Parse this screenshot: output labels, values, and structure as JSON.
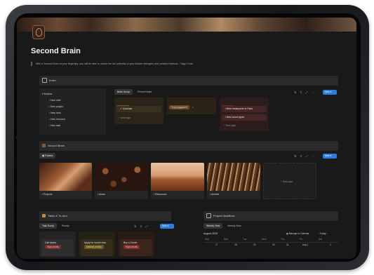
{
  "page": {
    "title": "Second Brain",
    "quote": "With a Second Brain at your fingertips, you will be able to unlock the full potential of your hidden strengths and creative instincts - Tiago Forte"
  },
  "index": {
    "label": "Index",
    "buttons_label": "Buttons",
    "buttons": [
      "New note",
      "New project",
      "New area",
      "New resource",
      "New task"
    ],
    "tabs": [
      "Brain Dump",
      "Pinned Notes"
    ],
    "new_label": "New",
    "columns": [
      {
        "name": "Thoughts",
        "count": "1",
        "cards": [
          {
            "title": "Couches"
          }
        ],
        "add": "New page"
      },
      {
        "name": "To be organized",
        "count": "0",
        "cards": [],
        "add": "New page"
      },
      {
        "name": "Relevant",
        "count": "2",
        "cards": [
          {
            "title": "Best restaurants in Paris"
          },
          {
            "title": "Best wood types"
          }
        ],
        "add": "New page"
      }
    ]
  },
  "second_brain": {
    "label": "Second Brain",
    "view": "Folders",
    "new_label": "New",
    "items": [
      {
        "label": "Projects"
      },
      {
        "label": "Areas"
      },
      {
        "label": "Resources"
      },
      {
        "label": "Archive"
      }
    ],
    "add": "New page"
  },
  "tasks": {
    "label": "Tasks & To-do's",
    "tabs": [
      "Task Dump",
      "Priority"
    ],
    "new_label": "New",
    "columns": [
      {
        "name": "Not started",
        "count": "0",
        "card": "Call doctor",
        "priority": "High priority"
      },
      {
        "name": "In progress",
        "count": "2",
        "card": "Apply for tourist visa",
        "priority": "Medium priority"
      },
      {
        "name": "Done",
        "count": "1",
        "card": "Buy a Couch",
        "priority": "High priority"
      }
    ]
  },
  "deadlines": {
    "label": "Project deadlines",
    "tabs": [
      "Weekly View",
      "Weekly View"
    ],
    "month": "August 2025",
    "manage": "Manage in Calendar",
    "today": "Today",
    "days": [
      "Sun",
      "Mon",
      "Tue",
      "Wed",
      "Thu",
      "Fri",
      "Sat"
    ],
    "dates": [
      "27",
      "28",
      "29",
      "30",
      "31",
      "Aug 1",
      "2"
    ]
  }
}
